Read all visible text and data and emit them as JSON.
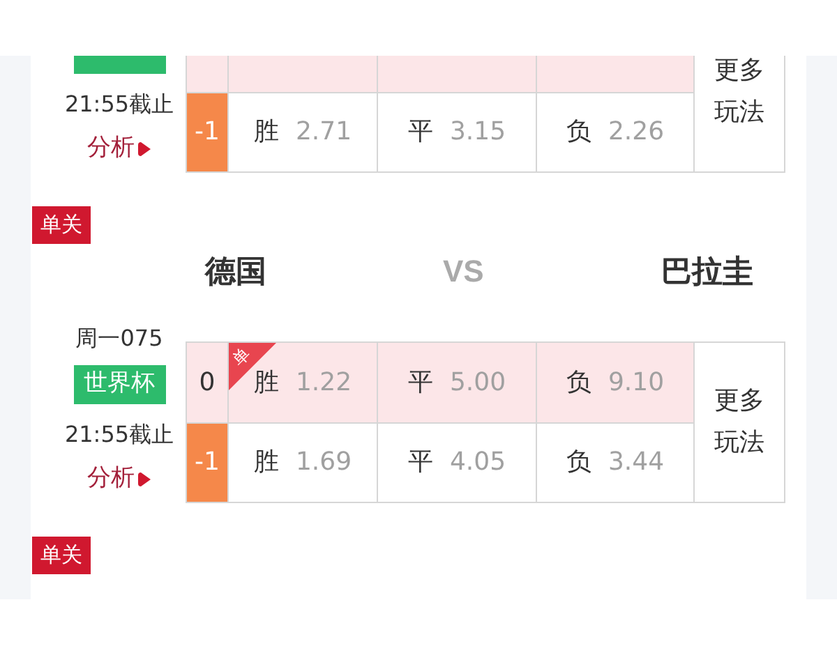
{
  "matches": [
    {
      "deadline": "21:55截止",
      "analysis": "分析",
      "more": "更多玩法",
      "rows": [
        {
          "kind": "standard"
        },
        {
          "kind": "handicap",
          "handicap": "-1",
          "odds": [
            {
              "label": "胜",
              "value": "2.71"
            },
            {
              "label": "平",
              "value": "3.15"
            },
            {
              "label": "负",
              "value": "2.26"
            }
          ]
        }
      ]
    },
    {
      "tag": "单关",
      "home": "德国",
      "vs": "VS",
      "away": "巴拉圭",
      "code": "周一075",
      "league": "世界杯",
      "deadline": "21:55截止",
      "analysis": "分析",
      "more": "更多玩法",
      "rows": [
        {
          "kind": "standard",
          "handicap": "0",
          "badge": "单",
          "odds": [
            {
              "label": "胜",
              "value": "1.22"
            },
            {
              "label": "平",
              "value": "5.00"
            },
            {
              "label": "负",
              "value": "9.10"
            }
          ]
        },
        {
          "kind": "handicap",
          "handicap": "-1",
          "odds": [
            {
              "label": "胜",
              "value": "1.69"
            },
            {
              "label": "平",
              "value": "4.05"
            },
            {
              "label": "负",
              "value": "3.44"
            }
          ]
        }
      ]
    },
    {
      "tag": "单关"
    }
  ]
}
